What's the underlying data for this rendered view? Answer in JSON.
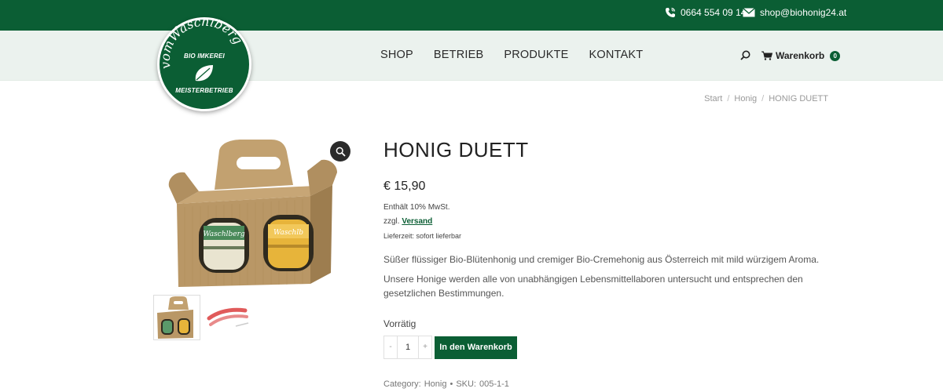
{
  "topbar": {
    "phone": "0664 554 09 14",
    "email": "shop@biohonig24.at"
  },
  "logo": {
    "script": "vomWaschlberg",
    "line1": "BIO IMKEREI",
    "line2": "MEISTERBETRIEB"
  },
  "nav": {
    "items": [
      "SHOP",
      "BETRIEB",
      "PRODUKTE",
      "KONTAKT"
    ]
  },
  "header": {
    "search_icon": "search-icon",
    "cart_label": "Warenkorb",
    "cart_count": "0"
  },
  "breadcrumb": {
    "items": [
      "Start",
      "Honig",
      "HONIG DUETT"
    ],
    "separator": "/"
  },
  "product": {
    "title": "HONIG DUETT",
    "price": "€ 15,90",
    "tax_note": "Enthält 10% MwSt.",
    "shipping_prefix": "zzgl.",
    "shipping_link": "Versand",
    "delivery": "Lieferzeit: sofort lieferbar",
    "description1": "Süßer flüssiger Bio-Blütenhonig und cremiger Bio-Cremehonig aus Österreich mit mild würzigem Aroma.",
    "description2": "Unsere Honige werden alle von unabhängigen Lebensmittellaboren untersucht und entsprechen den gesetzlichen Bestimmungen.",
    "stock": "Vorrätig",
    "quantity": "1",
    "qty_minus": "-",
    "qty_plus": "+",
    "add_to_cart": "In den Warenkorb",
    "category_label": "Category:",
    "category_value": "Honig",
    "meta_sep": "•",
    "sku_label": "SKU:",
    "sku_value": "005-1-1",
    "jar1_label": "Waschlberg",
    "jar2_label": "Waschlb"
  },
  "colors": {
    "brand_green": "#0b5e34",
    "header_bg": "#ebf2ee"
  }
}
